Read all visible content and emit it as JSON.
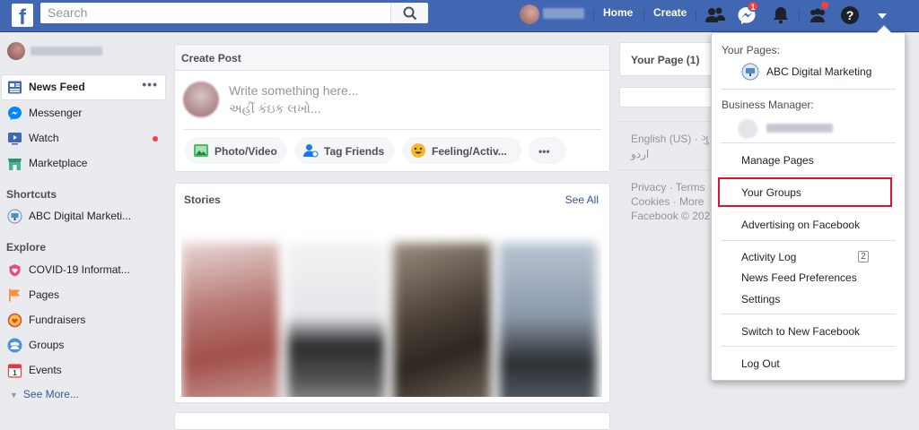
{
  "topbar": {
    "logo": "f",
    "search_placeholder": "Search",
    "home": "Home",
    "create": "Create",
    "messenger_badge": "1"
  },
  "left_nav": {
    "primary": [
      {
        "label": "News Feed",
        "icon": "news-feed-icon",
        "active": true
      },
      {
        "label": "Messenger",
        "icon": "messenger-icon"
      },
      {
        "label": "Watch",
        "icon": "watch-icon"
      },
      {
        "label": "Marketplace",
        "icon": "marketplace-icon"
      }
    ],
    "shortcuts_heading": "Shortcuts",
    "shortcuts": [
      {
        "label": "ABC Digital Marketi..."
      }
    ],
    "explore_heading": "Explore",
    "explore": [
      {
        "label": "COVID-19 Informat...",
        "icon": "covid-heart-icon"
      },
      {
        "label": "Pages",
        "icon": "pages-flag-icon"
      },
      {
        "label": "Fundraisers",
        "icon": "fundraisers-icon"
      },
      {
        "label": "Groups",
        "icon": "groups-icon"
      },
      {
        "label": "Events",
        "icon": "events-calendar-icon"
      }
    ],
    "see_more": "See More..."
  },
  "create_post": {
    "title": "Create Post",
    "placeholder_en": "Write something here...",
    "placeholder_gu": "અહીં કંઇક લખો...",
    "actions": [
      "Photo/Video",
      "Tag Friends",
      "Feeling/Activ...",
      "•••"
    ]
  },
  "stories": {
    "title": "Stories",
    "see_all": "See All"
  },
  "right_column": {
    "your_page": "Your Page (1)",
    "languages": "English (US) · ગુ",
    "lang2": "اردو",
    "footer_line1": "Privacy · Terms",
    "footer_line2": "Cookies · More",
    "footer_line3": "Facebook © 202"
  },
  "dropdown": {
    "your_pages_heading": "Your Pages:",
    "page_name": "ABC Digital Marketing",
    "business_manager_heading": "Business Manager:",
    "manage_pages": "Manage Pages",
    "your_groups": "Your Groups",
    "advertising": "Advertising on Facebook",
    "activity_log": "Activity Log",
    "activity_count": "2",
    "news_feed_prefs": "News Feed Preferences",
    "settings": "Settings",
    "switch": "Switch to New Facebook",
    "log_out": "Log Out"
  },
  "colors": {
    "brand_blue": "#4267b2",
    "highlight_red": "#e0112c",
    "badge_red": "#fa3e3e"
  }
}
